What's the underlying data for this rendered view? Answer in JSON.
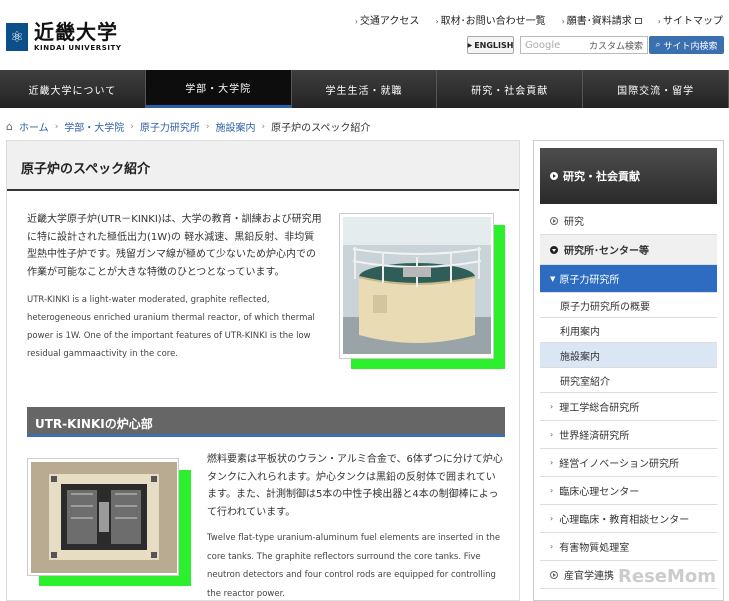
{
  "header": {
    "logo_mark": "⚛",
    "logo_jp": "近畿大学",
    "logo_en": "KINDAI UNIVERSITY",
    "toplinks": [
      {
        "label": "交通アクセス"
      },
      {
        "label": "取材･お問い合わせ一覧"
      },
      {
        "label": "願書･資料請求"
      },
      {
        "label": "サイトマップ"
      }
    ],
    "english_label": "ENGLISH",
    "search_placeholder": "Google",
    "search_custom": "カスタム検索",
    "search_button": "サイト内検索"
  },
  "nav": {
    "items": [
      {
        "label": "近畿大学について"
      },
      {
        "label": "学部・大学院"
      },
      {
        "label": "学生生活・就職"
      },
      {
        "label": "研究・社会貢献"
      },
      {
        "label": "国際交流・留学"
      }
    ]
  },
  "breadcrumb": {
    "items": [
      "ホーム",
      "学部・大学院",
      "原子力研究所",
      "施設案内"
    ],
    "current": "原子炉のスペック紹介"
  },
  "main": {
    "title": "原子炉のスペック紹介",
    "intro_jp": "近畿大学原子炉(UTR－KINKI)は、大学の教育・訓練および研究用に特に設計された極低出力(1W)の 軽水減速、黒鉛反射、非均質型熱中性子炉です。残留ガンマ線が極めて少ないため炉心内での作業が可能なことが大きな特徴のひとつとなっています。",
    "intro_en": "UTR-KINKI is a light-water moderated, graphite reflected, heterogeneous enriched uranium thermal reactor, of which thermal power is 1W. One of the important features of UTR-KINKI is the low residual gammaactivity in the core.",
    "section_title": "UTR-KINKIの炉心部",
    "core_jp": "燃料要素は平板状のウラン・アルミ合金で、6体ずつに分けて炉心タンクに入れられます。炉心タンクは黒鉛の反射体で囲まれています。また、計測制御は5本の中性子検出器と4本の制御棒によって行われています。",
    "core_en": "Twelve flat-type uranium-aluminum fuel elements are inserted in the core tanks. The graphite reflectors surround the core tanks. Five neutron detectors and four control rods are equipped for controlling the reactor power."
  },
  "sidebar": {
    "heading": "研究・社会貢献",
    "items": [
      {
        "label": "研究"
      },
      {
        "label": "研究所･センター等"
      },
      {
        "label": "原子力研究所"
      },
      {
        "label": "原子力研究所の概要"
      },
      {
        "label": "利用案内"
      },
      {
        "label": "施設案内"
      },
      {
        "label": "研究室紹介"
      },
      {
        "label": "理工学総合研究所"
      },
      {
        "label": "世界経済研究所"
      },
      {
        "label": "経営イノベーション研究所"
      },
      {
        "label": "臨床心理センター"
      },
      {
        "label": "心理臨床・教育相談センター"
      },
      {
        "label": "有害物質処理室"
      },
      {
        "label": "産官学連携"
      }
    ]
  },
  "watermark": "ReseMom",
  "colors": {
    "accent": "#2d6cc0",
    "highlight": "#2bf02b"
  }
}
